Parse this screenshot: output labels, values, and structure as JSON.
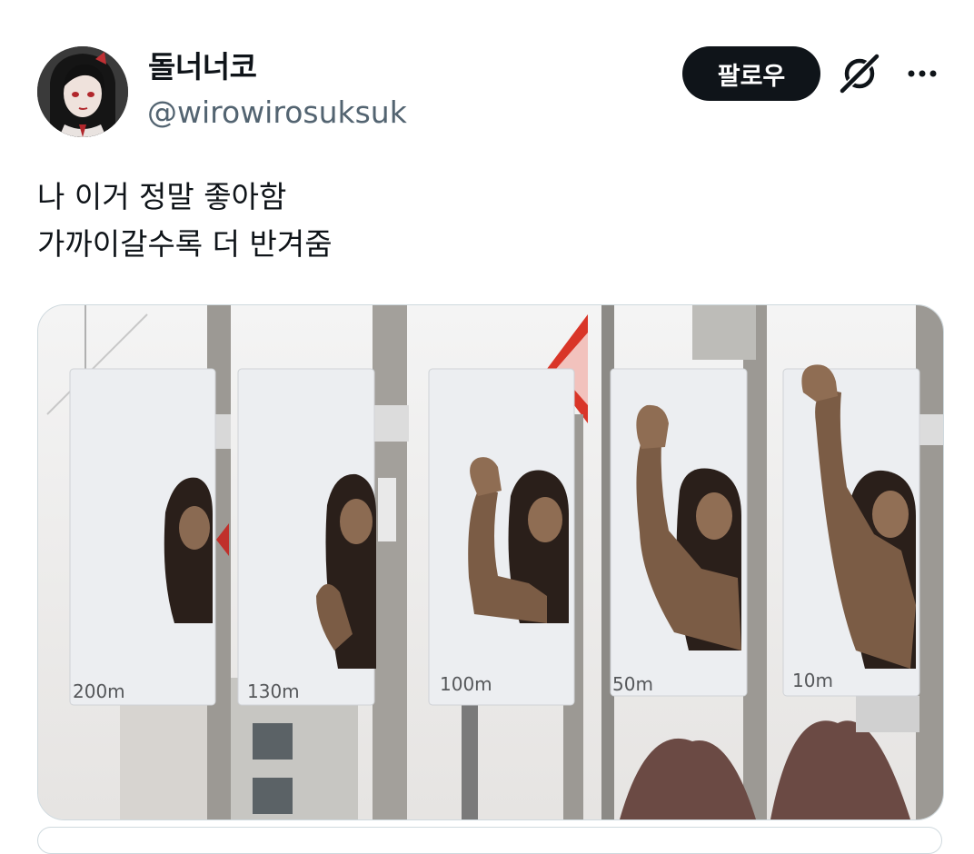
{
  "user": {
    "display_name": "돌너너코",
    "handle": "@wirowirosuksuk"
  },
  "actions": {
    "follow_label": "팔로우",
    "grok_icon": "grok-icon",
    "more_icon": "more-options-icon"
  },
  "tweet": {
    "lines": [
      "나 이거 정말 좋아함",
      "가까이갈수록 더 반겨줌"
    ]
  },
  "media": {
    "signs": [
      {
        "distance": "200m"
      },
      {
        "distance": "130m"
      },
      {
        "distance": "100m"
      },
      {
        "distance": "50m"
      },
      {
        "distance": "10m"
      }
    ]
  },
  "colors": {
    "text": "#0f1419",
    "secondary": "#536471",
    "button_bg": "#0f1419",
    "border": "#cfd9de"
  }
}
